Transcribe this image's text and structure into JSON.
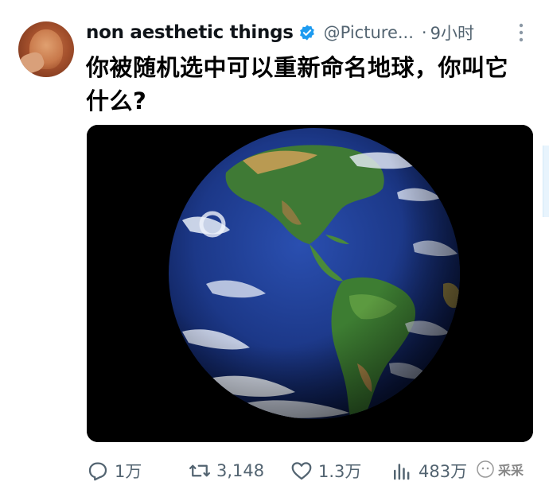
{
  "post": {
    "author_name": "non aesthetic things",
    "handle": "@Picture...",
    "separator": "·",
    "time": "9小时",
    "text": "你被随机选中可以重新命名地球，你叫它什么?"
  },
  "icons": {
    "verified": "verified-badge-icon",
    "more": "more-options-icon",
    "reply": "reply-icon",
    "retweet": "retweet-icon",
    "like": "like-icon",
    "views": "views-icon"
  },
  "metrics": {
    "replies": "1万",
    "retweets": "3,148",
    "likes": "1.3万",
    "views": "483万"
  },
  "watermark": {
    "text": "采采"
  },
  "colors": {
    "accent": "#1d9bf0",
    "secondary_text": "#536471",
    "primary_text": "#0f1419"
  }
}
